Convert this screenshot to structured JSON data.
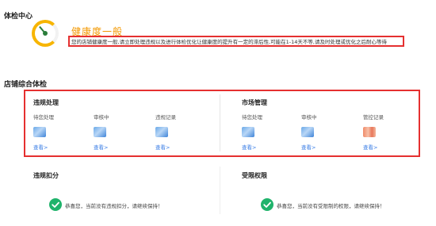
{
  "header": {
    "title": "体检中心"
  },
  "health": {
    "status": "健康度一般",
    "description": "您的店铺健康度一般,请立即处理违规以及进行体检优化让健康度的提升有一定的滞后性,可能在1-14天不等,请及时处理或优化之后耐心等待"
  },
  "overview": {
    "title": "店铺综合体检"
  },
  "violations": {
    "title": "违规处理",
    "columns": [
      {
        "label": "待您处理",
        "link": "查看>",
        "thumb": "blue"
      },
      {
        "label": "审核中",
        "link": "查看>",
        "thumb": "blue"
      },
      {
        "label": "违规记录",
        "link": "查看>",
        "thumb": "blue"
      }
    ]
  },
  "market": {
    "title": "市场管理",
    "columns": [
      {
        "label": "待您处理",
        "link": "查看>",
        "thumb": "blue"
      },
      {
        "label": "审核中",
        "link": "查看>",
        "thumb": "blue"
      },
      {
        "label": "管控记录",
        "link": "查看>",
        "thumb": "orange"
      }
    ]
  },
  "deduction": {
    "title": "违规扣分",
    "message": "恭喜您，当前没有违规扣分，请继续保持！"
  },
  "restriction": {
    "title": "受限权限",
    "message": "恭喜您，当前没有受限制的权限，请继续保持！"
  },
  "colors": {
    "accent_orange": "#f39800",
    "highlight_red": "#e53030",
    "link_blue": "#3a7ee6",
    "success_green": "#1fb36b"
  }
}
